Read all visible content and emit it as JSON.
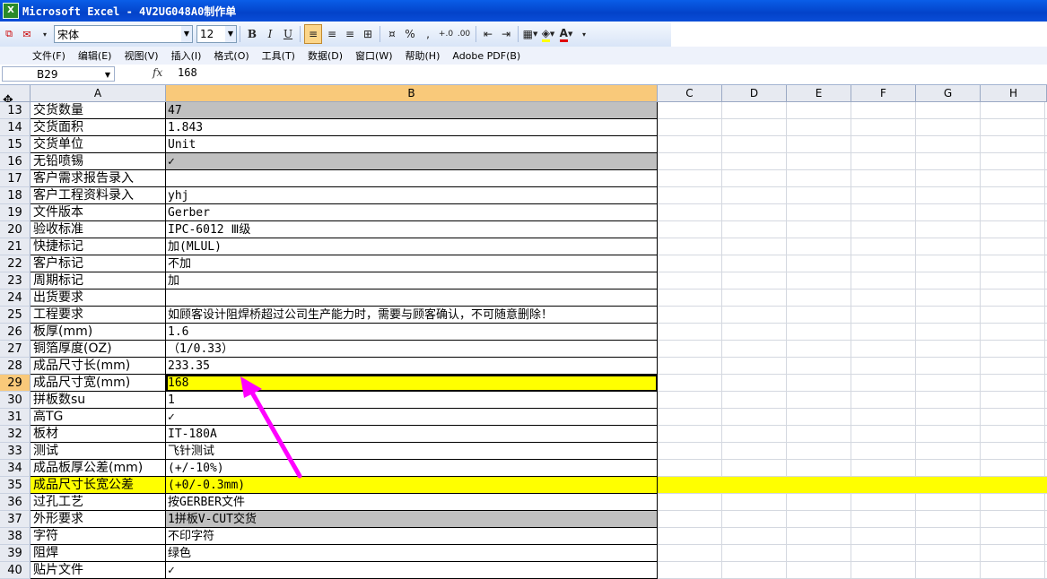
{
  "window": {
    "title": "Microsoft Excel - 4V2UG048A0制作单",
    "app_icon": "excel-icon"
  },
  "toolbar": {
    "font_name": "宋体",
    "font_size": "12",
    "bold": "B",
    "italic": "I",
    "underline": "U",
    "percent": "%",
    "comma": ",",
    "increase_decimal": "+.0",
    "decrease_decimal": ".00",
    "font_color_letter": "A",
    "accent": "#fcd68a"
  },
  "menu": [
    "文件(F)",
    "编辑(E)",
    "视图(V)",
    "插入(I)",
    "格式(O)",
    "工具(T)",
    "数据(D)",
    "窗口(W)",
    "帮助(H)",
    "Adobe PDF(B)"
  ],
  "formula_bar": {
    "name_box": "B29",
    "fx": "fx",
    "value": "168"
  },
  "columns": [
    "A",
    "B",
    "C",
    "D",
    "E",
    "F",
    "G",
    "H"
  ],
  "selected_column": "B",
  "selected_row": "29",
  "rows": [
    {
      "num": "13",
      "a": "交货数量",
      "b": "47",
      "fill": "gray"
    },
    {
      "num": "14",
      "a": "交货面积",
      "b": "1.843",
      "fill": ""
    },
    {
      "num": "15",
      "a": "交货单位",
      "b": "Unit",
      "fill": ""
    },
    {
      "num": "16",
      "a": "无铅喷锡",
      "b": "✓",
      "fill": "gray"
    },
    {
      "num": "17",
      "a": "客户需求报告录入",
      "b": "",
      "fill": ""
    },
    {
      "num": "18",
      "a": "客户工程资料录入",
      "b": "yhj",
      "fill": ""
    },
    {
      "num": "19",
      "a": "文件版本",
      "b": "Gerber",
      "fill": ""
    },
    {
      "num": "20",
      "a": "验收标准",
      "b": "IPC-6012 Ⅲ级",
      "fill": ""
    },
    {
      "num": "21",
      "a": "快捷标记",
      "b": "加(MLUL)",
      "fill": ""
    },
    {
      "num": "22",
      "a": "客户标记",
      "b": "不加",
      "fill": ""
    },
    {
      "num": "23",
      "a": "周期标记",
      "b": "加",
      "fill": ""
    },
    {
      "num": "24",
      "a": "出货要求",
      "b": "",
      "fill": ""
    },
    {
      "num": "25",
      "a": "工程要求",
      "b": "如顾客设计阻焊桥超过公司生产能力时，需要与顾客确认，不可随意删除！",
      "fill": ""
    },
    {
      "num": "26",
      "a": "板厚(mm)",
      "b": "1.6",
      "fill": ""
    },
    {
      "num": "27",
      "a": "铜箔厚度(OZ)",
      "b": "（1/0.33）",
      "fill": ""
    },
    {
      "num": "28",
      "a": "成品尺寸长(mm)",
      "b": "233.35",
      "fill": ""
    },
    {
      "num": "29",
      "a": "成品尺寸宽(mm)",
      "b": "168",
      "fill": "yellow-b"
    },
    {
      "num": "30",
      "a": "拼板数su",
      "b": "1",
      "fill": ""
    },
    {
      "num": "31",
      "a": "高TG",
      "b": "✓",
      "fill": ""
    },
    {
      "num": "32",
      "a": "板材",
      "b": "IT-180A",
      "fill": ""
    },
    {
      "num": "33",
      "a": "测试",
      "b": "飞针测试",
      "fill": ""
    },
    {
      "num": "34",
      "a": "成品板厚公差(mm)",
      "b": "(+/-10%)",
      "fill": ""
    },
    {
      "num": "35",
      "a": "成品尺寸长宽公差",
      "b": "(+0/-0.3mm)",
      "fill": "yellow-row"
    },
    {
      "num": "36",
      "a": "过孔工艺",
      "b": "按GERBER文件",
      "fill": ""
    },
    {
      "num": "37",
      "a": "外形要求",
      "b": "1拼板V-CUT交货",
      "fill": "gray"
    },
    {
      "num": "38",
      "a": "字符",
      "b": "不印字符",
      "fill": ""
    },
    {
      "num": "39",
      "a": "阻焊",
      "b": "绿色",
      "fill": ""
    },
    {
      "num": "40",
      "a": "贴片文件",
      "b": "✓",
      "fill": ""
    }
  ],
  "colors": {
    "highlight": "#ffff00",
    "gray_fill": "#c0c0c0",
    "annotation_arrow": "#ff00ff",
    "selection_header": "#f9c97a"
  }
}
